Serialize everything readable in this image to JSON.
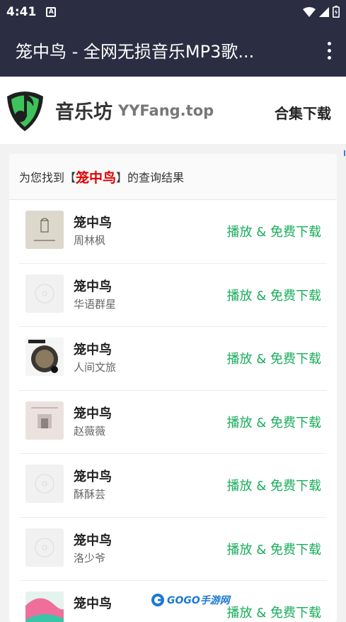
{
  "status": {
    "time": "4:41",
    "badge": "A"
  },
  "appbar": {
    "title": "笼中鸟 - 全网无损音乐MP3歌..."
  },
  "brand": {
    "name": "音乐坊",
    "domain": "YYFang.top",
    "link": "合集下载"
  },
  "results": {
    "prefix": "为您找到【",
    "keyword": "笼中鸟",
    "suffix": "】的查询结果",
    "songs": [
      {
        "title": "笼中鸟",
        "artist": "周林枫",
        "action": "播放 & 免费下载"
      },
      {
        "title": "笼中鸟",
        "artist": "华语群星",
        "action": "播放 & 免费下载"
      },
      {
        "title": "笼中鸟",
        "artist": "人间文旅",
        "action": "播放 & 免费下载"
      },
      {
        "title": "笼中鸟",
        "artist": "赵薇薇",
        "action": "播放 & 免费下载"
      },
      {
        "title": "笼中鸟",
        "artist": "酥酥芸",
        "action": "播放 & 免费下载"
      },
      {
        "title": "笼中鸟",
        "artist": "洛少爷",
        "action": "播放 & 免费下载"
      },
      {
        "title": "笼中鸟",
        "artist": "",
        "action": "播放 & 免费下载"
      }
    ]
  },
  "watermark": {
    "text": "GOGO手游网"
  },
  "colors": {
    "bar": "#2b2d42",
    "accent": "#1aad5b",
    "keyword": "#e00000"
  }
}
